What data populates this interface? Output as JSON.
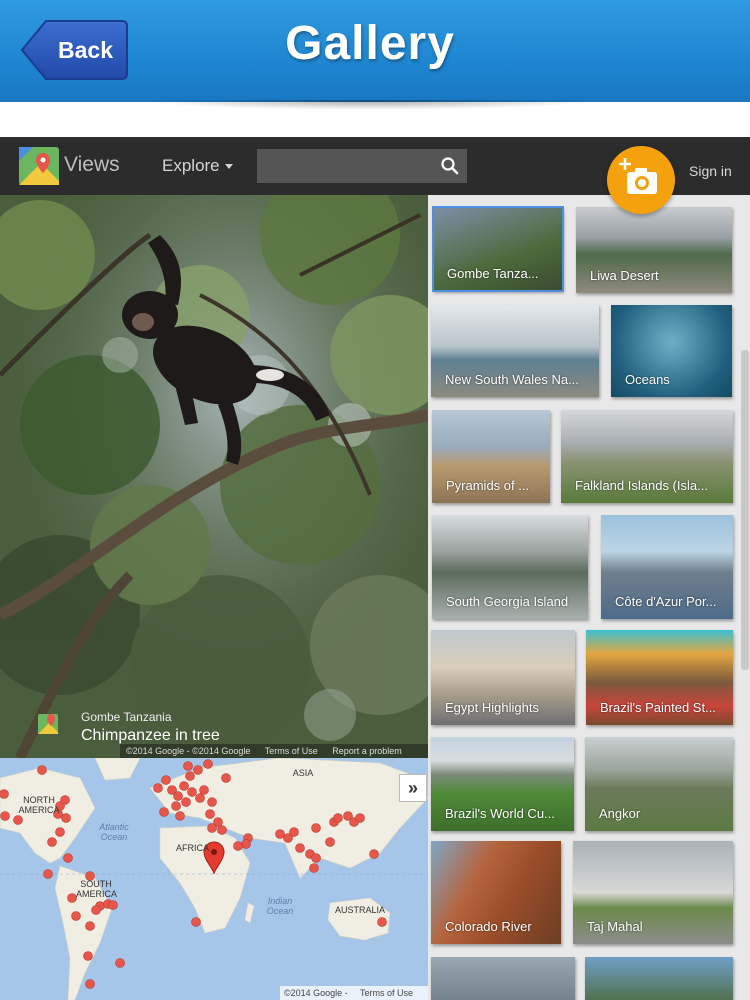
{
  "header": {
    "back_label": "Back",
    "title": "Gallery"
  },
  "nav": {
    "brand": "Views",
    "explore_label": "Explore",
    "search_value": "",
    "sign_in_label": "Sign in"
  },
  "photo": {
    "place": "Gombe Tanzania",
    "title": "Chimpanzee in tree",
    "footer": {
      "copyright": "©2014 Google - ©2014 Google",
      "terms": "Terms of Use",
      "report": "Report a problem"
    }
  },
  "map": {
    "labels": {
      "north_america": "NORTH AMERICA",
      "atlantic": "Atlantic Ocean",
      "africa": "AFRICA",
      "asia": "ASIA",
      "south_america": "SOUTH AMERICA",
      "indian": "Indian Ocean",
      "australia": "AUSTRALIA"
    },
    "footer": {
      "copyright": "©2014 Google -",
      "terms": "Terms of Use"
    },
    "expand_label": "»"
  },
  "gallery": {
    "items": [
      {
        "label": "Gombe Tanza...",
        "selected": true
      },
      {
        "label": "Liwa Desert"
      },
      {
        "label": "New South Wales Na..."
      },
      {
        "label": "Oceans"
      },
      {
        "label": "Pyramids of ..."
      },
      {
        "label": "Falkland Islands (Isla..."
      },
      {
        "label": "South Georgia Island"
      },
      {
        "label": "Côte d'Azur Por..."
      },
      {
        "label": "Egypt Highlights"
      },
      {
        "label": "Brazil's Painted St..."
      },
      {
        "label": "Brazil's World Cu..."
      },
      {
        "label": "Angkor"
      },
      {
        "label": "Colorado River"
      },
      {
        "label": "Taj Mahal"
      },
      {
        "label": ""
      },
      {
        "label": ""
      }
    ]
  },
  "colors": {
    "header_blue": "#1f86d1",
    "back_button": "#2b59b8",
    "nav_dark": "#2c2c2c",
    "fab_orange": "#f5a00d",
    "map_water": "#a6c6e9",
    "map_land": "#f0eee2",
    "map_marker": "#e8554a",
    "selected_outline": "#4a8fe0"
  }
}
